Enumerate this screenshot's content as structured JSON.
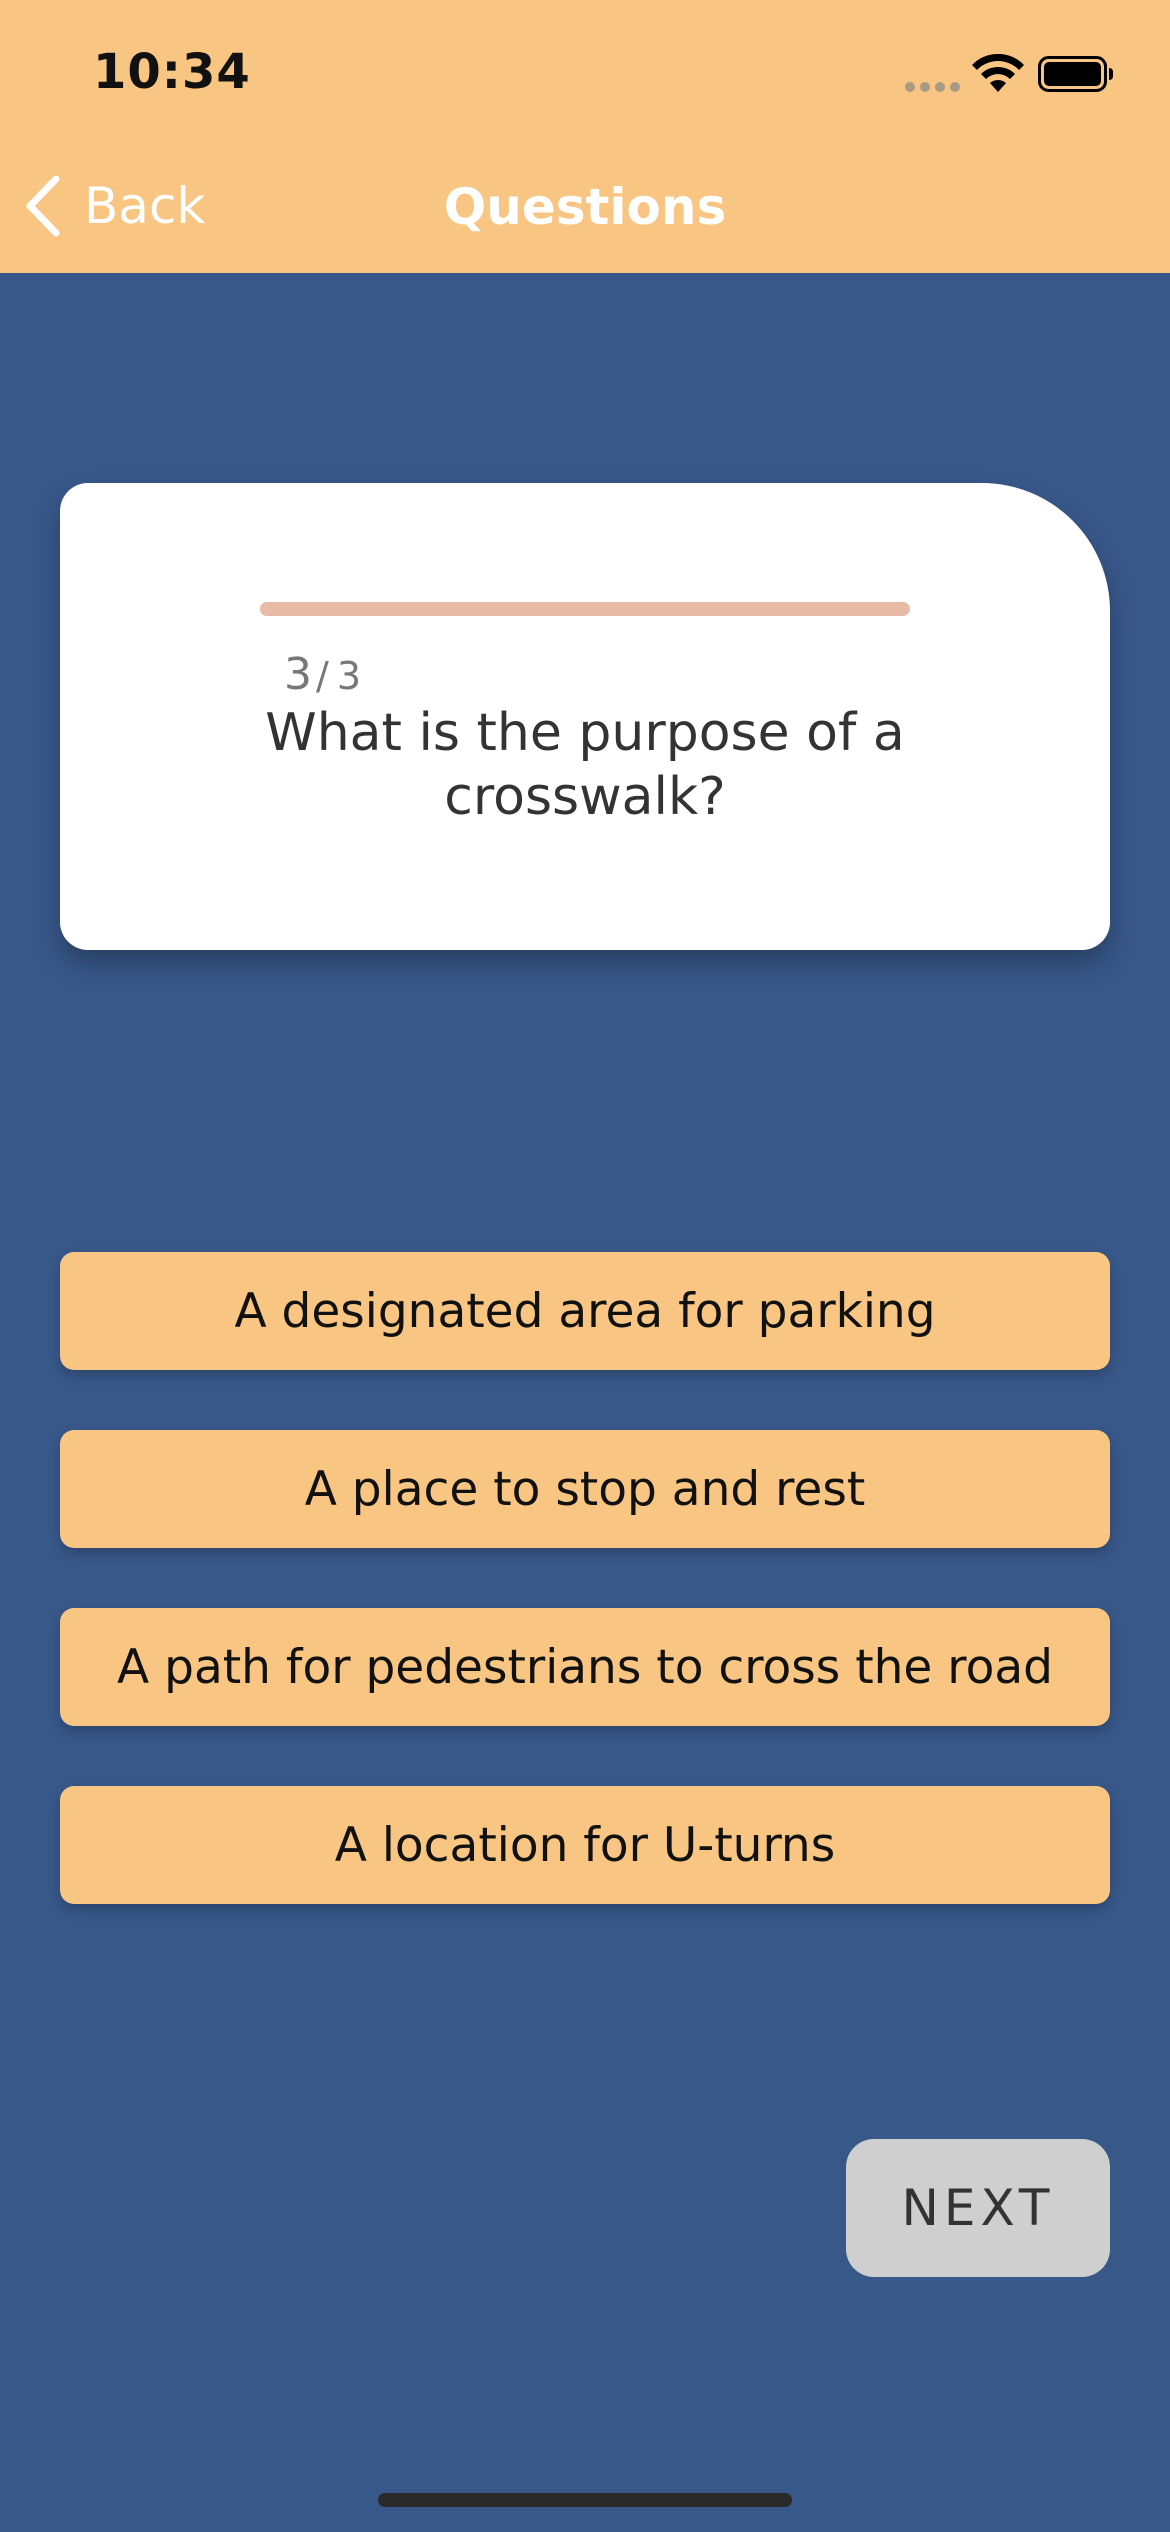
{
  "status_bar": {
    "time": "10:34",
    "icons": [
      "signal-dots-icon",
      "wifi-icon",
      "battery-icon"
    ]
  },
  "nav": {
    "back_label": "Back",
    "back_icon": "chevron-left-icon",
    "title": "Questions"
  },
  "question": {
    "current": "3",
    "separator": "/",
    "total": "3",
    "progress": 1.0,
    "text": "What is the purpose of a crosswalk?"
  },
  "answers": [
    {
      "label": "A designated area for parking"
    },
    {
      "label": "A place to stop and rest"
    },
    {
      "label": "A path for pedestrians to cross the road"
    },
    {
      "label": "A location for U-turns"
    }
  ],
  "next_label": "NEXT",
  "colors": {
    "accent": "#f8c682",
    "background": "#38588a",
    "progress_fill": "#e7bba5",
    "next_button": "#cfcfcf"
  }
}
